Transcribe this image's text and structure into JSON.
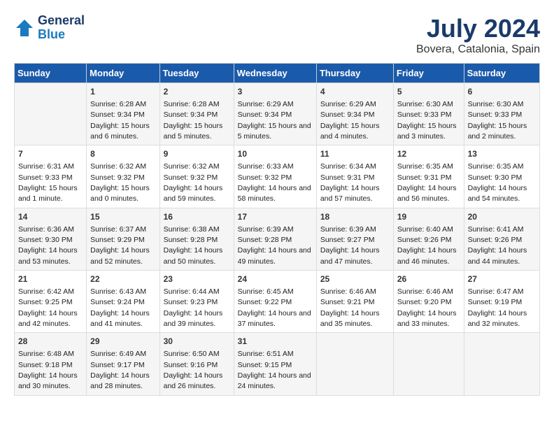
{
  "header": {
    "logo_line1": "General",
    "logo_line2": "Blue",
    "title": "July 2024",
    "subtitle": "Bovera, Catalonia, Spain"
  },
  "columns": [
    "Sunday",
    "Monday",
    "Tuesday",
    "Wednesday",
    "Thursday",
    "Friday",
    "Saturday"
  ],
  "weeks": [
    [
      {
        "day": "",
        "sunrise": "",
        "sunset": "",
        "daylight": ""
      },
      {
        "day": "1",
        "sunrise": "Sunrise: 6:28 AM",
        "sunset": "Sunset: 9:34 PM",
        "daylight": "Daylight: 15 hours and 6 minutes."
      },
      {
        "day": "2",
        "sunrise": "Sunrise: 6:28 AM",
        "sunset": "Sunset: 9:34 PM",
        "daylight": "Daylight: 15 hours and 5 minutes."
      },
      {
        "day": "3",
        "sunrise": "Sunrise: 6:29 AM",
        "sunset": "Sunset: 9:34 PM",
        "daylight": "Daylight: 15 hours and 5 minutes."
      },
      {
        "day": "4",
        "sunrise": "Sunrise: 6:29 AM",
        "sunset": "Sunset: 9:34 PM",
        "daylight": "Daylight: 15 hours and 4 minutes."
      },
      {
        "day": "5",
        "sunrise": "Sunrise: 6:30 AM",
        "sunset": "Sunset: 9:33 PM",
        "daylight": "Daylight: 15 hours and 3 minutes."
      },
      {
        "day": "6",
        "sunrise": "Sunrise: 6:30 AM",
        "sunset": "Sunset: 9:33 PM",
        "daylight": "Daylight: 15 hours and 2 minutes."
      }
    ],
    [
      {
        "day": "7",
        "sunrise": "Sunrise: 6:31 AM",
        "sunset": "Sunset: 9:33 PM",
        "daylight": "Daylight: 15 hours and 1 minute."
      },
      {
        "day": "8",
        "sunrise": "Sunrise: 6:32 AM",
        "sunset": "Sunset: 9:32 PM",
        "daylight": "Daylight: 15 hours and 0 minutes."
      },
      {
        "day": "9",
        "sunrise": "Sunrise: 6:32 AM",
        "sunset": "Sunset: 9:32 PM",
        "daylight": "Daylight: 14 hours and 59 minutes."
      },
      {
        "day": "10",
        "sunrise": "Sunrise: 6:33 AM",
        "sunset": "Sunset: 9:32 PM",
        "daylight": "Daylight: 14 hours and 58 minutes."
      },
      {
        "day": "11",
        "sunrise": "Sunrise: 6:34 AM",
        "sunset": "Sunset: 9:31 PM",
        "daylight": "Daylight: 14 hours and 57 minutes."
      },
      {
        "day": "12",
        "sunrise": "Sunrise: 6:35 AM",
        "sunset": "Sunset: 9:31 PM",
        "daylight": "Daylight: 14 hours and 56 minutes."
      },
      {
        "day": "13",
        "sunrise": "Sunrise: 6:35 AM",
        "sunset": "Sunset: 9:30 PM",
        "daylight": "Daylight: 14 hours and 54 minutes."
      }
    ],
    [
      {
        "day": "14",
        "sunrise": "Sunrise: 6:36 AM",
        "sunset": "Sunset: 9:30 PM",
        "daylight": "Daylight: 14 hours and 53 minutes."
      },
      {
        "day": "15",
        "sunrise": "Sunrise: 6:37 AM",
        "sunset": "Sunset: 9:29 PM",
        "daylight": "Daylight: 14 hours and 52 minutes."
      },
      {
        "day": "16",
        "sunrise": "Sunrise: 6:38 AM",
        "sunset": "Sunset: 9:28 PM",
        "daylight": "Daylight: 14 hours and 50 minutes."
      },
      {
        "day": "17",
        "sunrise": "Sunrise: 6:39 AM",
        "sunset": "Sunset: 9:28 PM",
        "daylight": "Daylight: 14 hours and 49 minutes."
      },
      {
        "day": "18",
        "sunrise": "Sunrise: 6:39 AM",
        "sunset": "Sunset: 9:27 PM",
        "daylight": "Daylight: 14 hours and 47 minutes."
      },
      {
        "day": "19",
        "sunrise": "Sunrise: 6:40 AM",
        "sunset": "Sunset: 9:26 PM",
        "daylight": "Daylight: 14 hours and 46 minutes."
      },
      {
        "day": "20",
        "sunrise": "Sunrise: 6:41 AM",
        "sunset": "Sunset: 9:26 PM",
        "daylight": "Daylight: 14 hours and 44 minutes."
      }
    ],
    [
      {
        "day": "21",
        "sunrise": "Sunrise: 6:42 AM",
        "sunset": "Sunset: 9:25 PM",
        "daylight": "Daylight: 14 hours and 42 minutes."
      },
      {
        "day": "22",
        "sunrise": "Sunrise: 6:43 AM",
        "sunset": "Sunset: 9:24 PM",
        "daylight": "Daylight: 14 hours and 41 minutes."
      },
      {
        "day": "23",
        "sunrise": "Sunrise: 6:44 AM",
        "sunset": "Sunset: 9:23 PM",
        "daylight": "Daylight: 14 hours and 39 minutes."
      },
      {
        "day": "24",
        "sunrise": "Sunrise: 6:45 AM",
        "sunset": "Sunset: 9:22 PM",
        "daylight": "Daylight: 14 hours and 37 minutes."
      },
      {
        "day": "25",
        "sunrise": "Sunrise: 6:46 AM",
        "sunset": "Sunset: 9:21 PM",
        "daylight": "Daylight: 14 hours and 35 minutes."
      },
      {
        "day": "26",
        "sunrise": "Sunrise: 6:46 AM",
        "sunset": "Sunset: 9:20 PM",
        "daylight": "Daylight: 14 hours and 33 minutes."
      },
      {
        "day": "27",
        "sunrise": "Sunrise: 6:47 AM",
        "sunset": "Sunset: 9:19 PM",
        "daylight": "Daylight: 14 hours and 32 minutes."
      }
    ],
    [
      {
        "day": "28",
        "sunrise": "Sunrise: 6:48 AM",
        "sunset": "Sunset: 9:18 PM",
        "daylight": "Daylight: 14 hours and 30 minutes."
      },
      {
        "day": "29",
        "sunrise": "Sunrise: 6:49 AM",
        "sunset": "Sunset: 9:17 PM",
        "daylight": "Daylight: 14 hours and 28 minutes."
      },
      {
        "day": "30",
        "sunrise": "Sunrise: 6:50 AM",
        "sunset": "Sunset: 9:16 PM",
        "daylight": "Daylight: 14 hours and 26 minutes."
      },
      {
        "day": "31",
        "sunrise": "Sunrise: 6:51 AM",
        "sunset": "Sunset: 9:15 PM",
        "daylight": "Daylight: 14 hours and 24 minutes."
      },
      {
        "day": "",
        "sunrise": "",
        "sunset": "",
        "daylight": ""
      },
      {
        "day": "",
        "sunrise": "",
        "sunset": "",
        "daylight": ""
      },
      {
        "day": "",
        "sunrise": "",
        "sunset": "",
        "daylight": ""
      }
    ]
  ]
}
